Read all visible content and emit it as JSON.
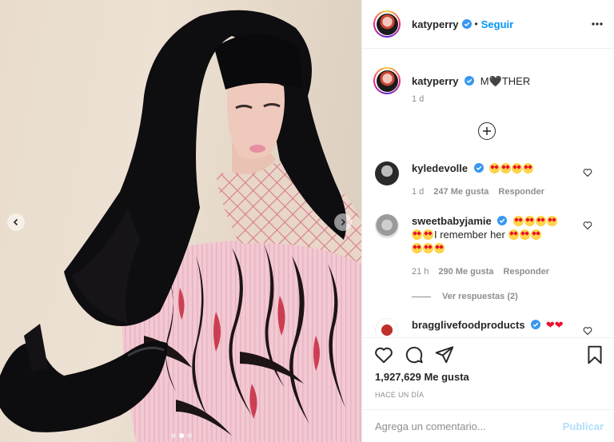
{
  "post": {
    "username": "katyperry",
    "follow_label": "Seguir",
    "separator": "•"
  },
  "caption": {
    "username": "katyperry",
    "text_before": "M",
    "heart": "🖤",
    "text_after": "THER",
    "time": "1 d"
  },
  "comments": [
    {
      "username": "kyledevolle",
      "emoji_line_1_count": 4,
      "text": "",
      "time": "1 d",
      "likes": "247 Me gusta",
      "reply_label": "Responder"
    },
    {
      "username": "sweetbabyjamie",
      "text": "I remember her",
      "time": "21 h",
      "likes": "290 Me gusta",
      "reply_label": "Responder",
      "view_replies": "Ver respuestas (2)"
    },
    {
      "username": "bragglivefoodproducts",
      "hearts": "❤❤"
    }
  ],
  "actions": {
    "likes_count": "1,927,629 Me gusta",
    "post_time": "HACE UN DÍA"
  },
  "composer": {
    "placeholder": "Agrega un comentario...",
    "publish_label": "Publicar"
  },
  "colors": {
    "accent": "#0095f6",
    "publish_disabled": "#b2dffc",
    "muted": "#8e8e8e",
    "border": "#efefef"
  },
  "icons": [
    "chevron-left-icon",
    "chevron-right-icon",
    "verified-badge-icon",
    "more-icon",
    "plus-circle-icon",
    "heart-outline-icon",
    "comment-icon",
    "share-icon",
    "bookmark-icon"
  ]
}
